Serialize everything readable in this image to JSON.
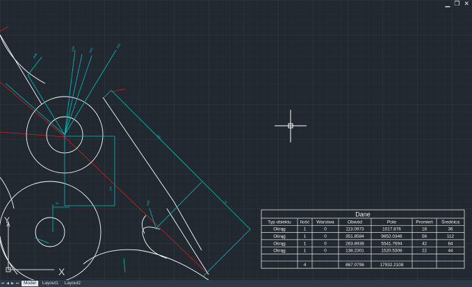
{
  "window": {
    "minimize_glyph": "▁",
    "restore_glyph": "❐",
    "close_glyph": "✕"
  },
  "tabs": {
    "nav": [
      "⏮",
      "◀",
      "▶",
      "⏭"
    ],
    "items": [
      {
        "label": "Model",
        "active": true
      },
      {
        "label": "Layout1",
        "active": false
      },
      {
        "label": "Layout2",
        "active": false
      }
    ]
  },
  "ucs": {
    "x_label": "X",
    "y_label": "Y"
  },
  "table": {
    "title": "Dane",
    "headers": [
      "Typ obiektu",
      "Ilość",
      "Warstwa",
      "Obwód",
      "Pole",
      "Promień",
      "Średnica"
    ],
    "rows": [
      [
        "Okrąg",
        "1",
        "0",
        "113.0973",
        "1017.876",
        "18",
        "36"
      ],
      [
        "Okrąg",
        "1",
        "0",
        "351.8584",
        "9852.0346",
        "56",
        "112"
      ],
      [
        "Okrąg",
        "1",
        "0",
        "263.8938",
        "5541.7694",
        "42",
        "84"
      ],
      [
        "Okrąg",
        "1",
        "0",
        "138.2301",
        "1520.5308",
        "22",
        "44"
      ]
    ],
    "blank_row": [
      "",
      "",
      "",
      "",
      "",
      "",
      ""
    ],
    "totals": [
      "",
      "4",
      "",
      "867.0796",
      "17932.2108",
      "",
      ""
    ]
  },
  "colors": {
    "background": "#212830",
    "grid_minor": "#2a3440",
    "grid_major": "#35414f",
    "geometry": "#ffffff",
    "dimension": "#00c8c8",
    "centerline": "#e02020"
  }
}
